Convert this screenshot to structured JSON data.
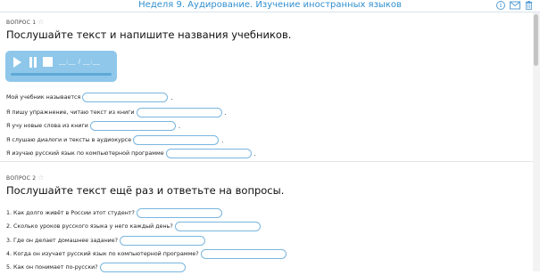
{
  "header": {
    "title": "Неделя 9. Аудирование. Изучение иностранных языков"
  },
  "icons": {
    "info": "info-icon",
    "mail": "mail-icon",
    "trash": "trash-icon",
    "star": "star-icon"
  },
  "colors": {
    "accent": "#2f8fd0",
    "player_bg": "#8ec7ea",
    "field_border": "#79b6df"
  },
  "q1": {
    "label": "ВОПРОС 1",
    "title": "Послушайте текст и напишите названия учебников.",
    "player": {
      "time": "__:__ / __:__"
    },
    "rows": [
      {
        "text": "Мой учебник называется",
        "suffix": "."
      },
      {
        "text": "Я пишу упражнение, читаю текст из книги",
        "suffix": "."
      },
      {
        "text": "Я учу новые слова из книги",
        "suffix": "."
      },
      {
        "text": "Я слушаю диалоги и тексты в аудиокурсе",
        "suffix": "."
      },
      {
        "text": "Я изучаю русский язык по компьютерной программе",
        "suffix": "."
      }
    ]
  },
  "q2": {
    "label": "ВОПРОС 2",
    "title": "Послушайте текст ещё раз и ответьте на вопросы.",
    "rows": [
      {
        "text": "1. Как долго живёт в России этот студент?"
      },
      {
        "text": "2. Сколько уроков русского языка у него каждый день?"
      },
      {
        "text": "3. Где он делает домашнее задание?"
      },
      {
        "text": "4. Когда он изучает русский язык по компьютерной программе?"
      },
      {
        "text": "5. Как он понимает по-русски?"
      }
    ]
  }
}
